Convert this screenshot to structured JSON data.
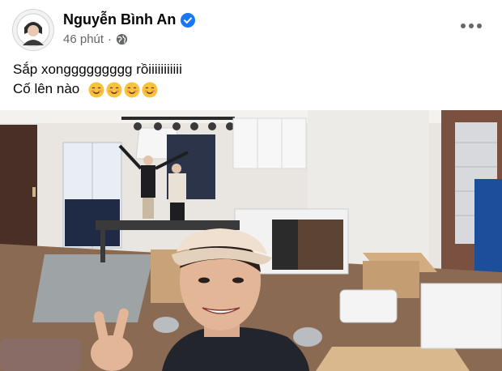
{
  "post": {
    "author_name": "Nguyễn Bình An",
    "verified": true,
    "time": "46 phút",
    "separator": "·",
    "audience_icon": "globe-icon",
    "more_icon": "more-options-icon",
    "text_line1": "Sắp xonggggggggg rồiiiiiiiiiii",
    "text_line2": "Cố lên nào",
    "emojis": [
      "blushing-smile-emoji",
      "blushing-smile-emoji",
      "blushing-smile-emoji",
      "blushing-smile-emoji"
    ],
    "photo_description": ""
  },
  "colors": {
    "verified_blue": "#1877f2",
    "meta_gray": "#65676b",
    "text": "#050505"
  }
}
